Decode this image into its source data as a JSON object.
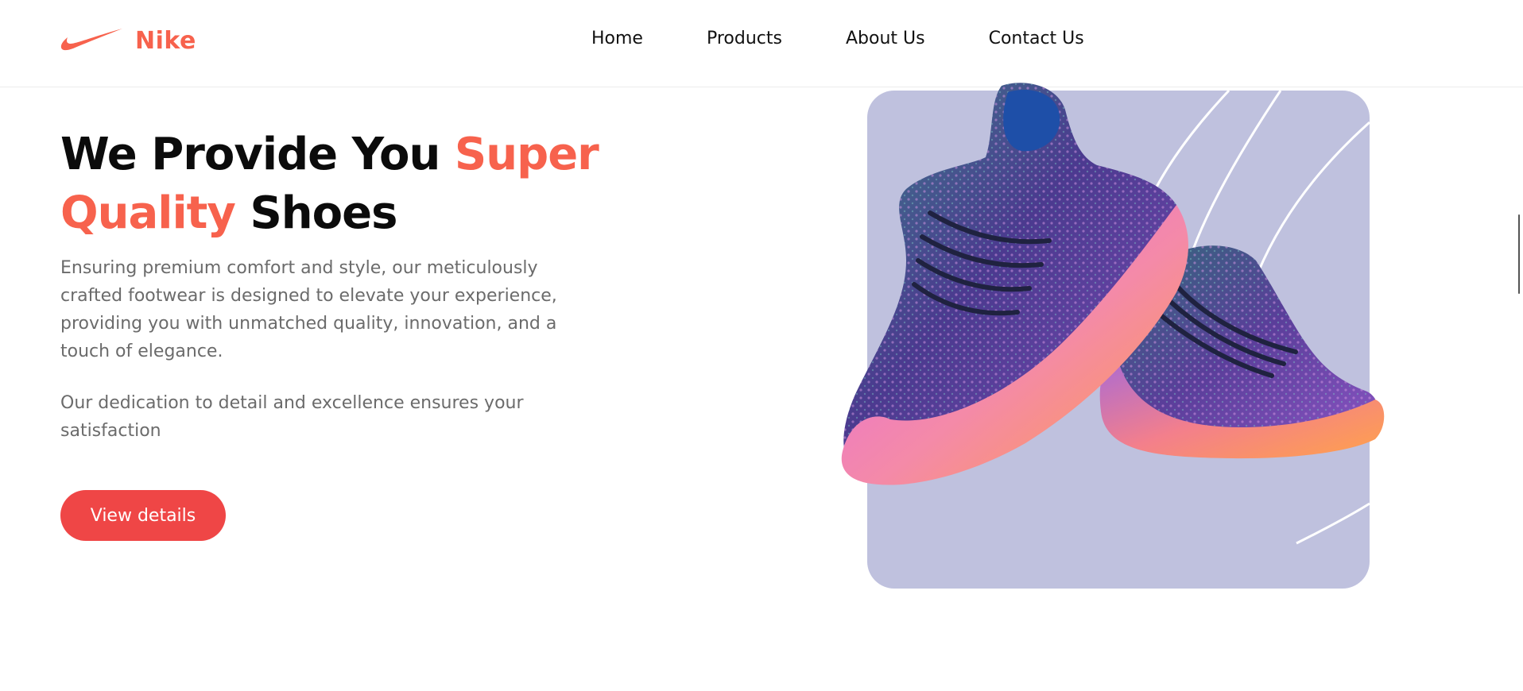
{
  "header": {
    "brand": "Nike",
    "nav": [
      "Home",
      "Products",
      "About Us",
      "Contact Us"
    ]
  },
  "hero": {
    "title_part1": "We Provide You",
    "title_accent1": "Super",
    "title_accent2": "Quality",
    "title_part2": "Shoes",
    "description": "Ensuring premium comfort and style, our meticulously crafted footwear is designed to elevate your experience, providing you with unmatched quality, innovation, and a touch of elegance.",
    "description2": "Our dedication to detail and excellence ensures your satisfaction",
    "cta_label": "View details"
  },
  "colors": {
    "accent": "#f7624d",
    "button": "#ef4646",
    "card_bg": "#bfc1de",
    "text_muted": "#6b6b6b"
  },
  "icons": {
    "logo": "nike-swoosh-icon"
  }
}
